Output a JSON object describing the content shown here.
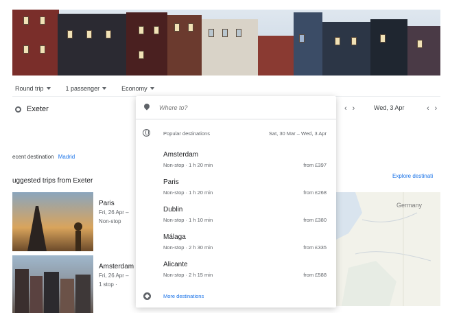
{
  "options": {
    "trip_type": "Round trip",
    "passengers": "1 passenger",
    "cabin": "Economy"
  },
  "search": {
    "origin": "Exeter",
    "destination_placeholder": "Where to?",
    "return_date": "Wed, 3 Apr"
  },
  "dropdown": {
    "popular_label": "Popular destinations",
    "popular_dates": "Sat, 30 Mar – Wed, 3 Apr",
    "destinations": [
      {
        "name": "Amsterdam",
        "detail": "Non-stop · 1 h 20 min",
        "price": "from £397"
      },
      {
        "name": "Paris",
        "detail": "Non-stop · 1 h 20 min",
        "price": "from £268"
      },
      {
        "name": "Dublin",
        "detail": "Non-stop · 1 h 10 min",
        "price": "from £380"
      },
      {
        "name": "Málaga",
        "detail": "Non-stop · 2 h 30 min",
        "price": "from £335"
      },
      {
        "name": "Alicante",
        "detail": "Non-stop · 2 h 15 min",
        "price": "from £588"
      }
    ],
    "more_label": "More destinations"
  },
  "recent": {
    "label": "ecent destination",
    "link": "Madrid"
  },
  "suggested": {
    "title": "uggested trips from Exeter",
    "trips": [
      {
        "city": "Paris",
        "date": "Fri, 26 Apr –",
        "stops": "Non-stop"
      },
      {
        "city": "Amsterdam",
        "date": "Fri, 26 Apr –",
        "stops": "1 stop ·"
      }
    ]
  },
  "explore": "Explore destinati",
  "map": {
    "country": "Germany"
  }
}
